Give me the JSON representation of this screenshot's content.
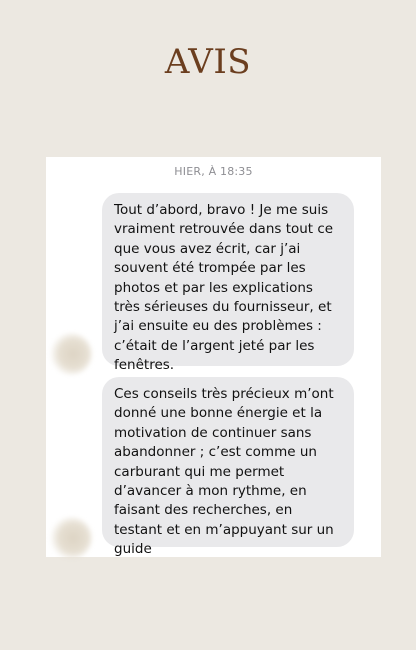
{
  "header": {
    "title": "AVIS"
  },
  "conversation": {
    "timestamp": "HIER, À 18:35",
    "messages": [
      {
        "text": "Tout d’abord, bravo ! Je me suis vraiment retrouvée dans tout ce que vous avez écrit, car j’ai souvent été trompée par les photos et par les explications très sérieuses du fournisseur, et j’ai ensuite eu des problèmes : c’était de l’argent jeté par les fenêtres."
      },
      {
        "text": "Ces conseils très précieux m’ont donné une bonne énergie et la motivation de continuer sans abandonner ; c’est comme un carburant qui me permet d’avancer à mon rythme, en faisant des recherches, en testant et en m’appuyant sur un guide"
      }
    ]
  },
  "colors": {
    "background": "#ece8e1",
    "title": "#6b3e1f",
    "bubble": "#e9e9eb",
    "timestamp": "#8e8e93"
  },
  "icons": {
    "sender_avatar": "blurred-avatar"
  }
}
